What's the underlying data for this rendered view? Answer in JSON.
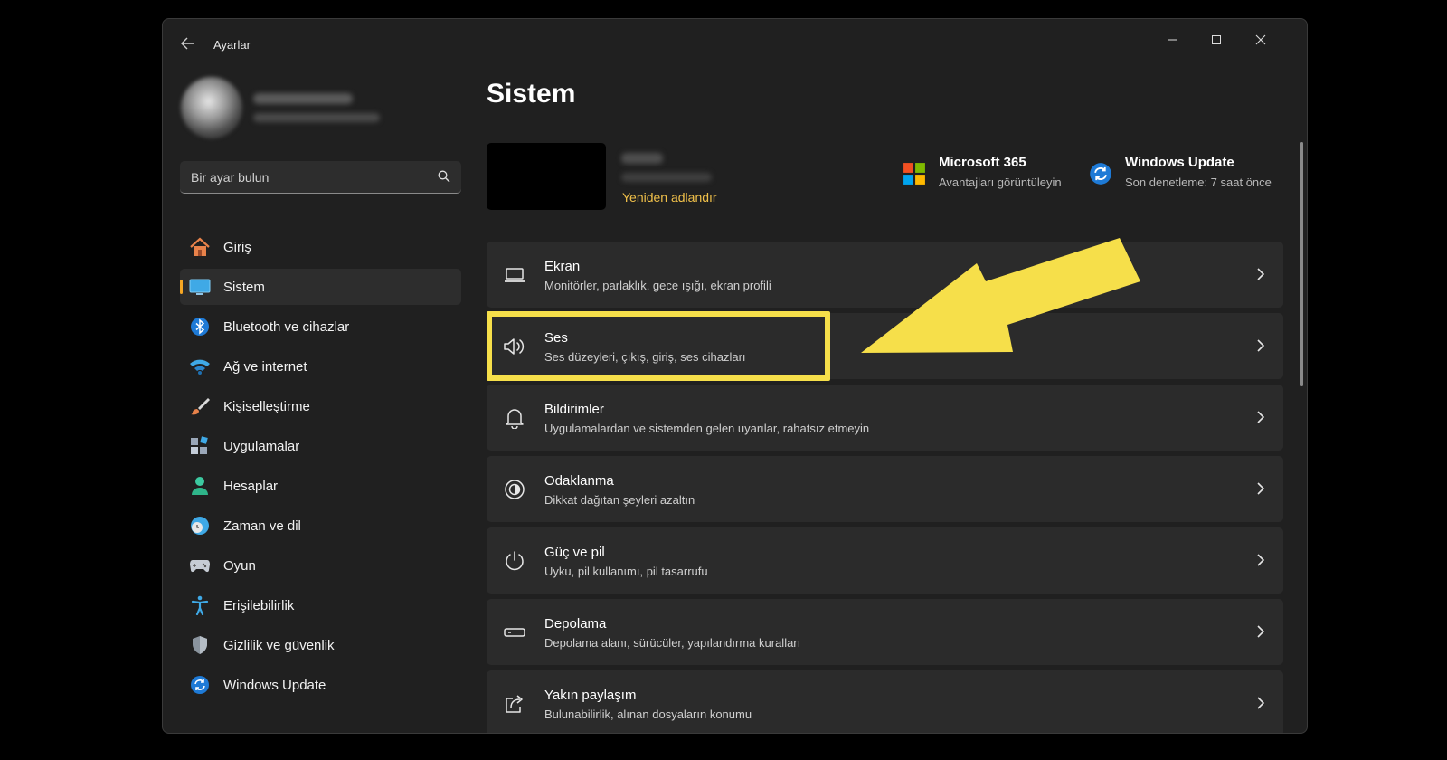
{
  "window": {
    "app_title": "Ayarlar"
  },
  "search": {
    "placeholder": "Bir ayar bulun"
  },
  "sidebar": {
    "items": [
      {
        "label": "Giriş",
        "icon": "home-icon"
      },
      {
        "label": "Sistem",
        "icon": "monitor-icon",
        "active": true
      },
      {
        "label": "Bluetooth ve cihazlar",
        "icon": "bluetooth-icon"
      },
      {
        "label": "Ağ ve internet",
        "icon": "wifi-icon"
      },
      {
        "label": "Kişiselleştirme",
        "icon": "brush-icon"
      },
      {
        "label": "Uygulamalar",
        "icon": "apps-icon"
      },
      {
        "label": "Hesaplar",
        "icon": "person-icon"
      },
      {
        "label": "Zaman ve dil",
        "icon": "clock-globe-icon"
      },
      {
        "label": "Oyun",
        "icon": "gamepad-icon"
      },
      {
        "label": "Erişilebilirlik",
        "icon": "accessibility-icon"
      },
      {
        "label": "Gizlilik ve güvenlik",
        "icon": "shield-icon"
      },
      {
        "label": "Windows Update",
        "icon": "update-icon"
      }
    ]
  },
  "main": {
    "title": "Sistem",
    "device": {
      "rename_label": "Yeniden adlandır"
    },
    "quick_links": [
      {
        "title": "Microsoft 365",
        "subtitle": "Avantajları görüntüleyin",
        "icon": "microsoft-logo-icon"
      },
      {
        "title": "Windows Update",
        "subtitle": "Son denetleme: 7 saat önce",
        "icon": "update-icon"
      }
    ],
    "rows": [
      {
        "title": "Ekran",
        "subtitle": "Monitörler, parlaklık, gece ışığı, ekran profili",
        "icon": "laptop-icon"
      },
      {
        "title": "Ses",
        "subtitle": "Ses düzeyleri, çıkış, giriş, ses cihazları",
        "icon": "speaker-icon",
        "highlighted": true
      },
      {
        "title": "Bildirimler",
        "subtitle": "Uygulamalardan ve sistemden gelen uyarılar, rahatsız etmeyin",
        "icon": "bell-icon"
      },
      {
        "title": "Odaklanma",
        "subtitle": "Dikkat dağıtan şeyleri azaltın",
        "icon": "focus-icon"
      },
      {
        "title": "Güç ve pil",
        "subtitle": "Uyku, pil kullanımı, pil tasarrufu",
        "icon": "power-icon"
      },
      {
        "title": "Depolama",
        "subtitle": "Depolama alanı, sürücüler, yapılandırma kuralları",
        "icon": "storage-icon"
      },
      {
        "title": "Yakın paylaşım",
        "subtitle": "Bulunabilirlik, alınan dosyaların konumu",
        "icon": "share-icon"
      }
    ]
  },
  "colors": {
    "accent": "#f5a623",
    "link": "#f0c04a",
    "highlight": "#f6df4a",
    "window_bg": "#202020",
    "card_bg": "#2b2b2b"
  }
}
